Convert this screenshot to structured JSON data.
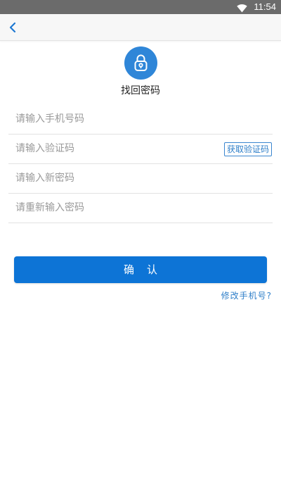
{
  "status_bar": {
    "time": "11:54",
    "wifi_icon": "wifi-icon",
    "background": "#6b6b6b"
  },
  "app_bar": {
    "back_icon": "chevron-left-icon"
  },
  "header": {
    "icon": "lock-icon",
    "icon_color": "#2f86d8",
    "title": "找回密码"
  },
  "form": {
    "phone_placeholder": "请输入手机号码",
    "code_placeholder": "请输入验证码",
    "get_code_label": "获取验证码",
    "new_password_placeholder": "请输入新密码",
    "repeat_password_placeholder": "请重新输入密码"
  },
  "actions": {
    "confirm_label": "确认",
    "confirm_color": "#0d74d6",
    "change_phone_label": "修改手机号?"
  }
}
